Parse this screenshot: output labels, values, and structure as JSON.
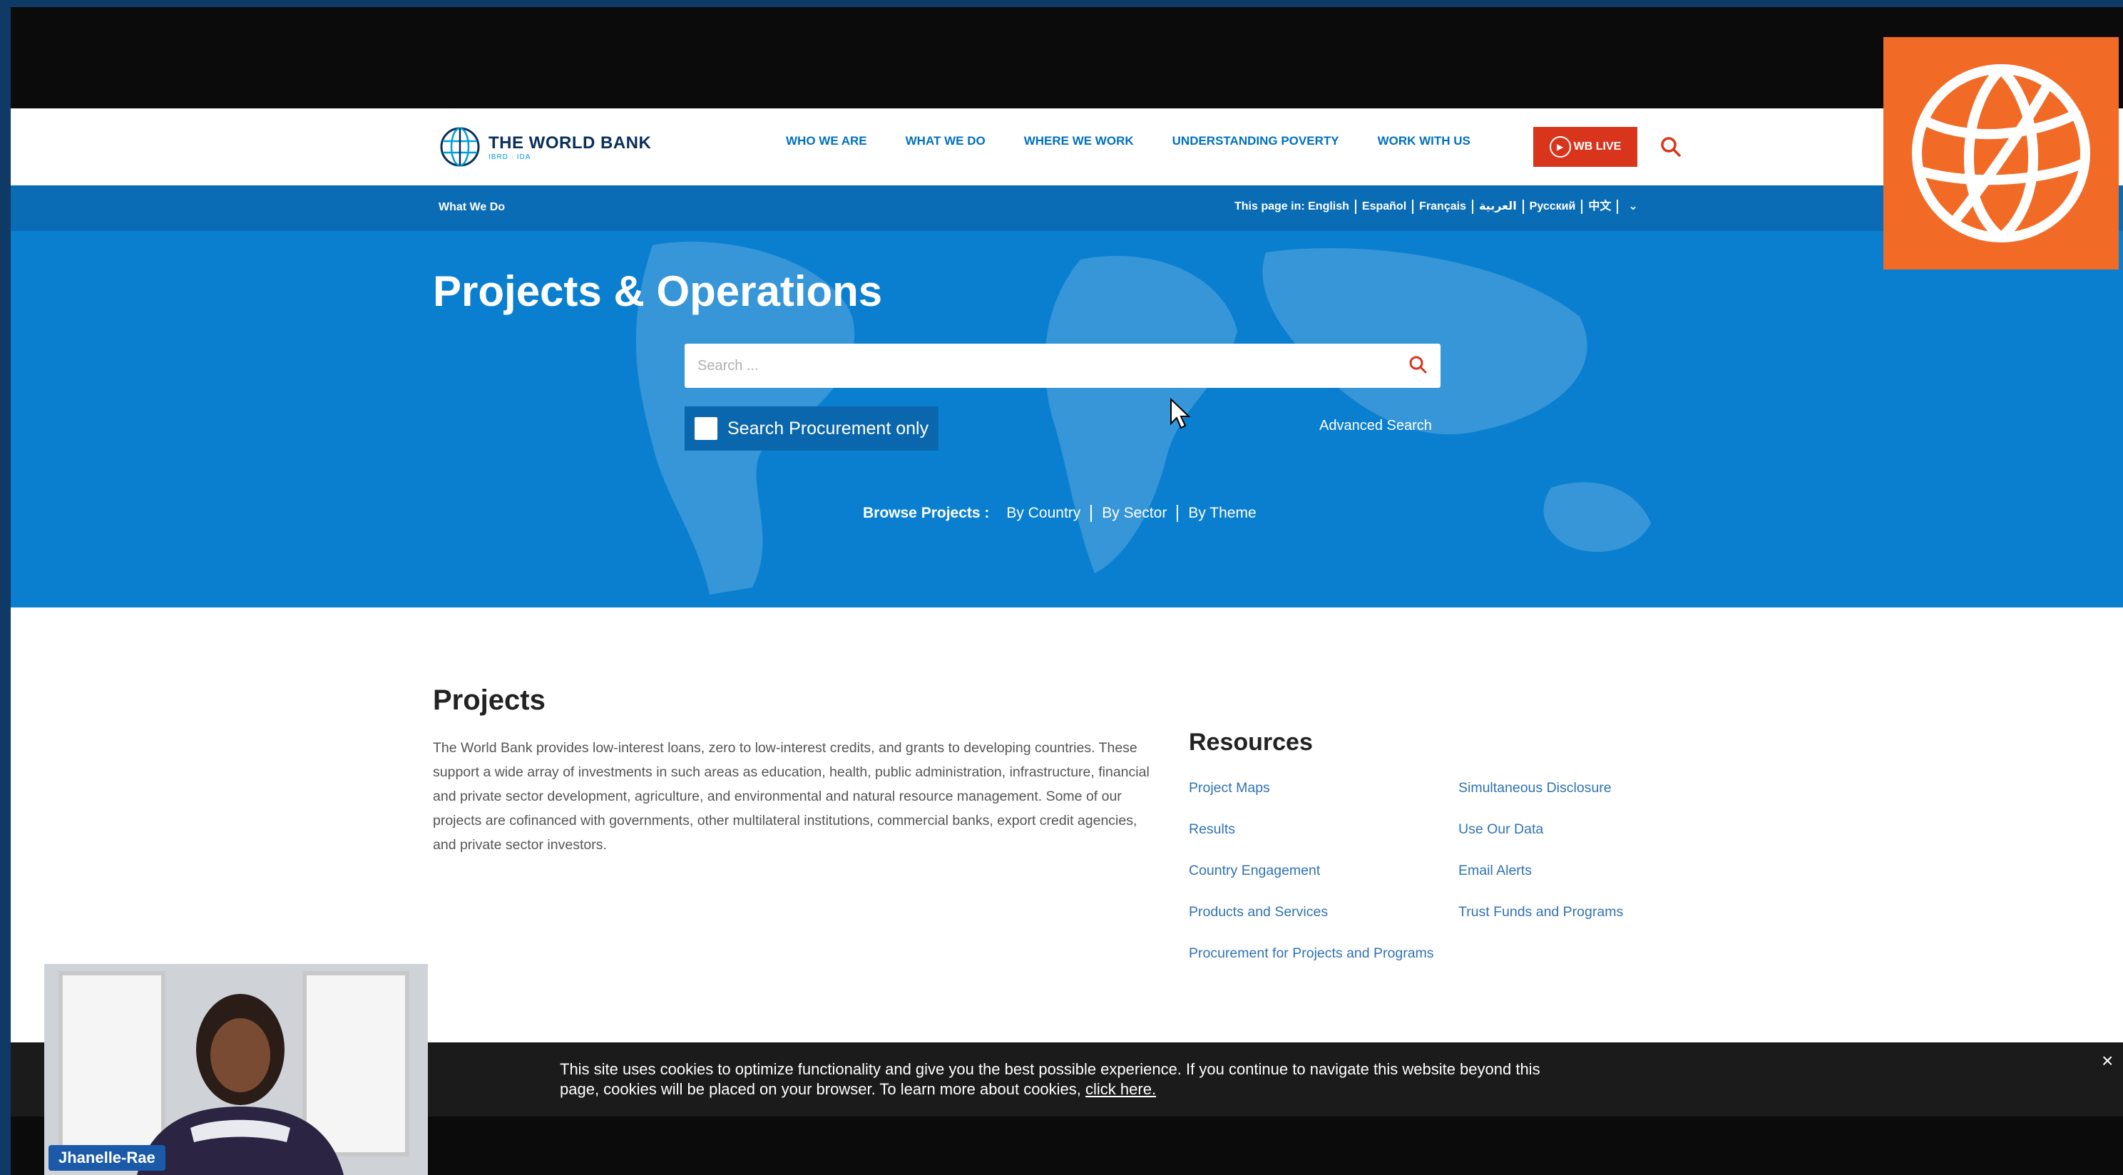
{
  "site": {
    "logo": {
      "name": "THE WORLD BANK",
      "sub": "IBRD · IDA"
    },
    "nav": [
      "WHO WE ARE",
      "WHAT WE DO",
      "WHERE WE WORK",
      "UNDERSTANDING POVERTY",
      "WORK WITH US"
    ],
    "live_label": "WB LIVE",
    "subnav": {
      "section": "What We Do",
      "languages": [
        "This page in: English",
        "Español",
        "Français",
        "العربية",
        "Русский",
        "中文"
      ]
    },
    "hero": {
      "title": "Projects & Operations",
      "search_placeholder": "Search ...",
      "procurement_label": "Search Procurement only",
      "advanced_search": "Advanced Search",
      "browse_label": "Browse Projects :",
      "browse_links": [
        "By Country",
        "By Sector",
        "By Theme"
      ]
    },
    "projects": {
      "title": "Projects",
      "description": "The World Bank provides low-interest loans, zero to low-interest credits, and grants to developing countries. These support a wide array of investments in such areas as education, health, public administration, infrastructure, financial and private sector development, agriculture, and environmental and natural resource management. Some of our projects are cofinanced with governments, other multilateral institutions, commercial banks, export credit agencies, and private sector investors."
    },
    "resources": {
      "title": "Resources",
      "links": [
        "Project Maps",
        "Simultaneous Disclosure",
        "Results",
        "Use Our Data",
        "Country Engagement",
        "Email Alerts",
        "Products and Services",
        "Trust Funds and Programs",
        "Procurement for Projects and Programs"
      ]
    },
    "cookie": {
      "text": "This site uses cookies to optimize functionality and give you the best possible experience. If you continue to navigate this website beyond this page, cookies will be placed on your browser. To learn more about cookies,",
      "link": "click here.",
      "close": "×"
    }
  },
  "webcam": {
    "name": "Jhanelle-Rae"
  },
  "colors": {
    "brand_blue": "#0a7fd0",
    "nav_blue": "#0071bc",
    "live_red": "#d8351c",
    "orange": "#f26b26"
  }
}
